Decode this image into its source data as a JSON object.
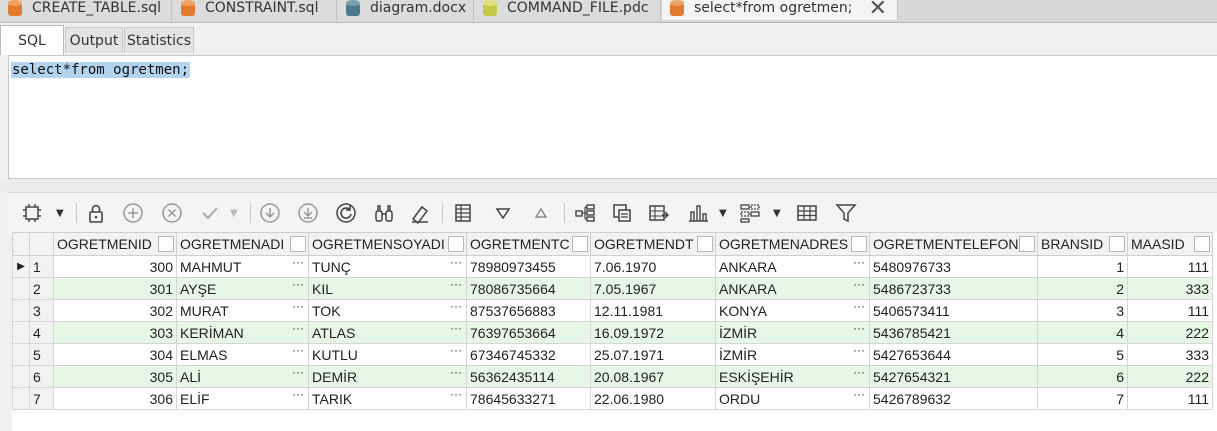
{
  "doc_tabs": [
    {
      "label": "CREATE_TABLE.sql",
      "icon": "database-icon",
      "color": "#e07a2e"
    },
    {
      "label": "CONSTRAINT.sql",
      "icon": "database-icon",
      "color": "#e07a2e"
    },
    {
      "label": "diagram.docx",
      "icon": "database-icon",
      "color": "#4a7a8c"
    },
    {
      "label": "COMMAND_FILE.pdc",
      "icon": "database-icon",
      "color": "#c8c84a"
    },
    {
      "label": "select*from ogretmen;",
      "icon": "database-icon",
      "color": "#e07a2e"
    }
  ],
  "sub_tabs": [
    "SQL",
    "Output",
    "Statistics"
  ],
  "editor": {
    "text": "select*from ogretmen;"
  },
  "grid": {
    "columns": [
      "OGRETMENID",
      "OGRETMENADI",
      "OGRETMENSOYADI",
      "OGRETMENTC",
      "OGRETMENDT",
      "OGRETMENADRES",
      "OGRETMENTELEFON",
      "BRANSID",
      "MAASID"
    ],
    "rows": [
      [
        "1",
        "300",
        "MAHMUT",
        "TUNÇ",
        "78980973455",
        "7.06.1970",
        "ANKARA",
        "5480976733",
        "1",
        "111"
      ],
      [
        "2",
        "301",
        "AYŞE",
        "KIL",
        "78086735664",
        "7.05.1967",
        "ANKARA",
        "5486723733",
        "2",
        "333"
      ],
      [
        "3",
        "302",
        "MURAT",
        "TOK",
        "87537656883",
        "12.11.1981",
        "KONYA",
        "5406573411",
        "3",
        "111"
      ],
      [
        "4",
        "303",
        "KERİMAN",
        "ATLAS",
        "76397653664",
        "16.09.1972",
        "İZMİR",
        "5436785421",
        "4",
        "222"
      ],
      [
        "5",
        "304",
        "ELMAS",
        "KUTLU",
        "67346745332",
        "25.07.1971",
        "İZMİR",
        "5427653644",
        "5",
        "333"
      ],
      [
        "6",
        "305",
        "ALİ",
        "DEMİR",
        "56362435114",
        "20.08.1967",
        "ESKİŞEHİR",
        "5427654321",
        "6",
        "222"
      ],
      [
        "7",
        "306",
        "ELİF",
        "TARIK",
        "78645633271",
        "22.06.1980",
        "ORDU",
        "5426789632",
        "7",
        "111"
      ]
    ],
    "ellipsis": "···",
    "current_row_marker": "▶"
  },
  "colors": {
    "even_row": "#e6f7e6",
    "selection": "#b3d4f0"
  }
}
